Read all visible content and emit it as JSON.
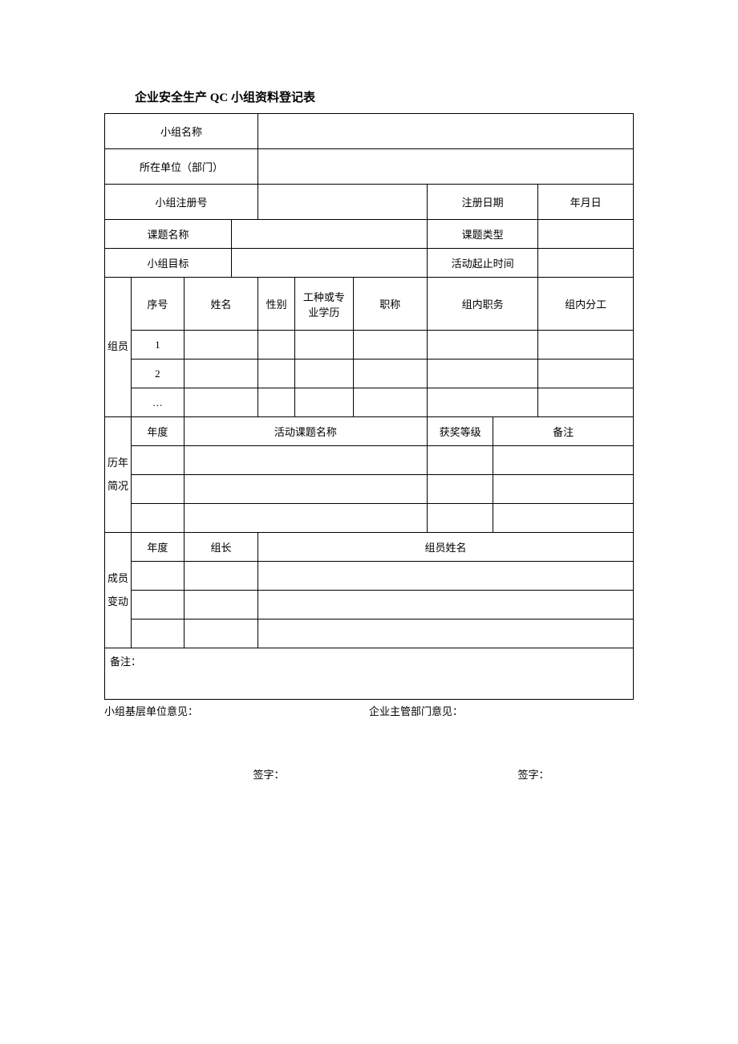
{
  "title": "企业安全生产 QC 小组资料登记表",
  "labels": {
    "team_name": "小组名称",
    "department": "所在单位（部门）",
    "reg_no": "小组注册号",
    "reg_date": "注册日期",
    "date_ymd": "年月日",
    "topic_name": "课题名称",
    "topic_type": "课题类型",
    "team_goal": "小组目标",
    "activity_period": "活动起止时间",
    "members_side": "组员",
    "mem_index": "序号",
    "mem_name": "姓名",
    "mem_gender": "性别",
    "mem_trade": "工种或专业学历",
    "mem_title": "职称",
    "mem_role": "组内职务",
    "mem_duty": "组内分工",
    "mem_r1": "1",
    "mem_r2": "2",
    "mem_r3": "…",
    "history_side": "历年简况",
    "hist_year": "年度",
    "hist_activity": "活动课题名称",
    "hist_award": "获奖等级",
    "hist_remark": "备注",
    "changes_side": "成员变动",
    "chg_year": "年度",
    "chg_leader": "组长",
    "chg_members": "组员姓名",
    "remarks": "备注：",
    "footer_left": "小组基层单位意见：",
    "footer_right": "企业主管部门意见：",
    "sign": "签字："
  }
}
